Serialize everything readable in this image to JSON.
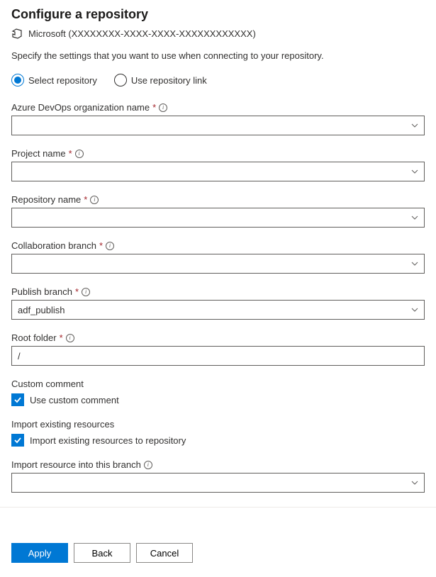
{
  "title": "Configure a repository",
  "org_text": "Microsoft (XXXXXXXX-XXXX-XXXX-XXXXXXXXXXXX)",
  "description": "Specify the settings that you want to use when connecting to your repository.",
  "radios": {
    "select_repo": "Select repository",
    "use_link": "Use repository link"
  },
  "fields": {
    "org_name": {
      "label": "Azure DevOps organization name",
      "value": ""
    },
    "project_name": {
      "label": "Project name",
      "value": ""
    },
    "repo_name": {
      "label": "Repository name",
      "value": ""
    },
    "collab_branch": {
      "label": "Collaboration branch",
      "value": ""
    },
    "publish_branch": {
      "label": "Publish branch",
      "value": "adf_publish"
    },
    "root_folder": {
      "label": "Root folder",
      "value": "/"
    }
  },
  "custom_comment": {
    "section": "Custom comment",
    "label": "Use custom comment"
  },
  "import_existing": {
    "section": "Import existing resources",
    "label": "Import existing resources to repository"
  },
  "import_branch": {
    "label": "Import resource into this branch",
    "value": ""
  },
  "buttons": {
    "apply": "Apply",
    "back": "Back",
    "cancel": "Cancel"
  }
}
